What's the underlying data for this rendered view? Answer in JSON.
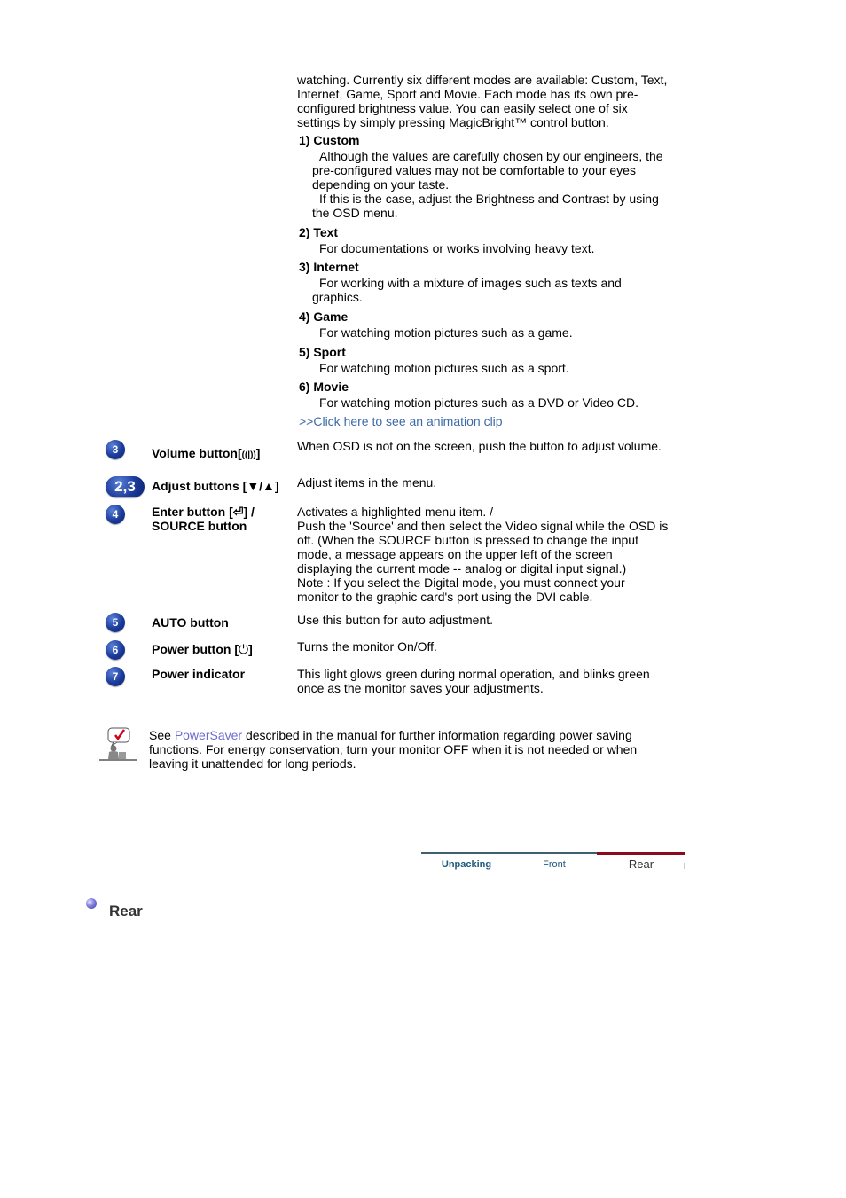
{
  "intro": "watching. Currently six different modes are available: Custom, Text, Internet, Game, Sport and Movie. Each mode has its own pre-configured brightness value. You can easily select one of six settings by simply pressing MagicBright™ control button.",
  "modes": [
    {
      "title": "1) Custom",
      "desc1": "Although the values are carefully chosen by our engineers, the pre-configured values may not be comfortable to your eyes depending on your taste.",
      "desc2": "If this is the case, adjust the Brightness and Contrast by using the OSD menu."
    },
    {
      "title": "2) Text",
      "desc1": "For documentations or works involving heavy text."
    },
    {
      "title": "3) Internet",
      "desc1": "For working with a mixture of images such as texts and graphics."
    },
    {
      "title": "4) Game",
      "desc1": "For watching motion pictures such as a game."
    },
    {
      "title": "5) Sport",
      "desc1": "For watching motion pictures such as a sport."
    },
    {
      "title": "6) Movie",
      "desc1": "For watching motion pictures such as a DVD or Video CD."
    }
  ],
  "animation_link": ">>Click here to see an animation clip",
  "buttons": [
    {
      "badge": "3",
      "label": "Volume button[🔈]",
      "label_text": "Volume button[",
      "label_icon": "((|))",
      "label_end": "]",
      "desc": "When OSD is not on the screen, push the button to adjust volume."
    },
    {
      "badge": "2,3",
      "label_text": "Adjust buttons [",
      "label_icon": "▼/▲",
      "label_end": "]",
      "desc": "Adjust items in the menu."
    },
    {
      "badge": "4",
      "label_text": "Enter button [",
      "label_icon": "⏎",
      "label_end": "] /",
      "label_line2": "SOURCE button",
      "desc": "Activates a highlighted menu item. /",
      "desc2": "Push the 'Source' and then select the Video signal while the OSD is off. (When the SOURCE button is pressed to change the input mode, a message appears on the upper left of the screen displaying the current mode -- analog or digital input signal.)",
      "desc3": "Note : If you select the Digital mode, you must connect your monitor to the graphic card's port using the DVI cable."
    },
    {
      "badge": "5",
      "label_text": "AUTO button",
      "desc": "Use this button for auto adjustment."
    },
    {
      "badge": "6",
      "label_text": "Power button [",
      "label_icon": "⏻",
      "label_end": "]",
      "desc": "Turns the monitor On/Off."
    },
    {
      "badge": "7",
      "label_text": "Power indicator",
      "desc": "This light glows green during normal operation, and blinks green once as the monitor saves your adjustments."
    }
  ],
  "note": {
    "icon": "note-check-icon",
    "prefix": "See ",
    "link": "PowerSaver",
    "suffix": " described in the manual for further information regarding power saving functions. For energy conservation, turn your monitor OFF when it is not needed or when leaving it unattended for long periods."
  },
  "tabs": [
    {
      "label": "Unpacking",
      "active": false
    },
    {
      "label": "Front",
      "active": false
    },
    {
      "label": "Rear",
      "active": true
    }
  ],
  "colors": {
    "link": "#3c6aa8",
    "powersaver_link": "#6b6bcf",
    "tab_inactive_line": "#3f5f6e",
    "tab_active_line": "#8b0a1e",
    "tab_text": "#1f5a7a",
    "badge": "#1b3a9a"
  },
  "section_heading": "Rear"
}
